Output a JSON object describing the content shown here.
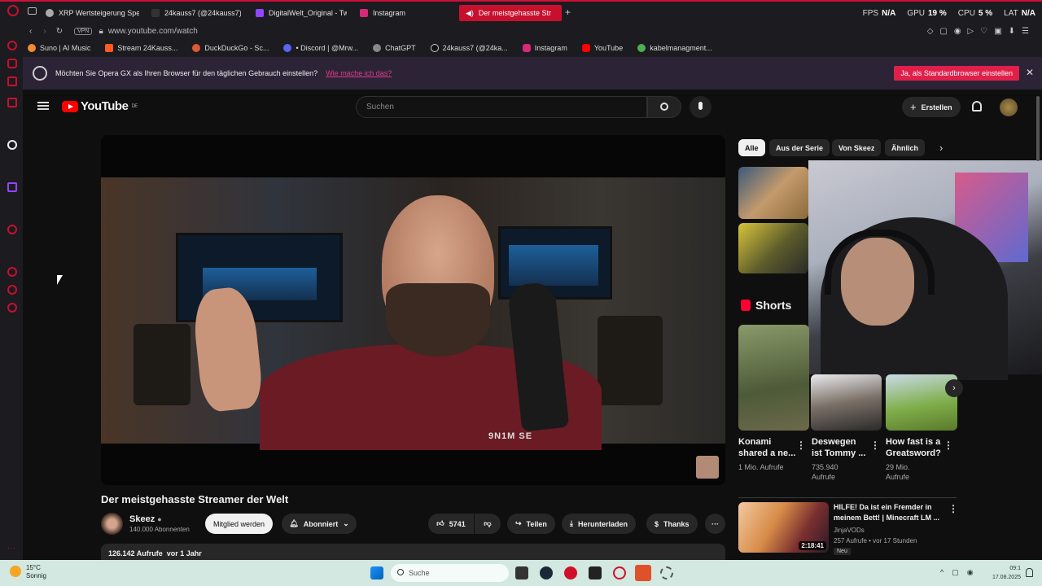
{
  "browser": {
    "tabs": [
      {
        "label": "XRP Wertsteigerung Spe..."
      },
      {
        "label": "24kauss7 (@24kauss7) |"
      },
      {
        "label": "DigitalWelt_Original - Twi"
      },
      {
        "label": "Instagram"
      },
      {
        "label": "Der meistgehasste Str"
      }
    ],
    "stats": {
      "fps_label": "FPS",
      "fps_value": "N/A",
      "gpu_label": "GPU",
      "gpu_value": "19 %",
      "cpu_label": "CPU",
      "cpu_value": "5 %",
      "lat_label": "LAT",
      "lat_value": "N/A"
    },
    "vpn_label": "VPN",
    "url": "www.youtube.com/watch",
    "bookmarks": [
      {
        "label": "Suno | AI Music",
        "color": "#f28b30"
      },
      {
        "label": "Stream 24Kauss...",
        "color": "#ff5a1f"
      },
      {
        "label": "DuckDuckGo - Sc...",
        "color": "#de5833"
      },
      {
        "label": "• Discord | @Mrw...",
        "color": "#5865f2"
      },
      {
        "label": "ChatGPT",
        "color": "#888888"
      },
      {
        "label": "24kauss7 (@24ka...",
        "color": "#222222"
      },
      {
        "label": "Instagram",
        "color": "#d62976"
      },
      {
        "label": "YouTube",
        "color": "#ff0000"
      },
      {
        "label": "kabelmanagment...",
        "color": "#4caf50"
      }
    ],
    "infobar": {
      "text": "Möchten Sie Opera GX als Ihren Browser für den täglichen Gebrauch einstellen?",
      "link": "Wie mache ich das?",
      "cta": "Ja, als Standardbrowser einstellen",
      "close": "✕"
    }
  },
  "youtube": {
    "logo_text": "YouTube",
    "logo_region": "DE",
    "search_placeholder": "Suchen",
    "create_label": "Erstellen",
    "video": {
      "watermark": "9N1M SE",
      "title": "Der meistgehasste Streamer der Welt",
      "channel": "Skeez",
      "subscribers": "140.000 Abonnenten",
      "join_label": "Mitglied werden",
      "subscribed_label": "Abonniert",
      "likes": "5741",
      "share_label": "Teilen",
      "download_label": "Herunterladen",
      "thanks_label": "Thanks",
      "views": "126.142 Aufrufe",
      "age": "vor 1 Jahr"
    },
    "chips": [
      "Alle",
      "Aus der Serie",
      "Von Skeez",
      "Ähnlich"
    ],
    "shorts_title": "Shorts",
    "shorts": [
      {
        "title_l1": "Konami",
        "title_l2": "shared a ne...",
        "meta_l1": "1 Mio. Aufrufe",
        "meta_l2": ""
      },
      {
        "title_l1": "Deswegen",
        "title_l2": "ist Tommy ...",
        "meta_l1": "735.940",
        "meta_l2": "Aufrufe"
      },
      {
        "title_l1": "How fast is a",
        "title_l2": "Greatsword?",
        "meta_l1": "29 Mio.",
        "meta_l2": "Aufrufe"
      }
    ],
    "rec_video": {
      "title_l1": "HILFE! Da ist ein Fremder in",
      "title_l2": "meinem Bett! | Minecraft LM ...",
      "channel": "JinjaVODs",
      "meta": "257 Aufrufe • vor 17 Stunden",
      "badge": "Neu",
      "duration": "2:18:41"
    }
  },
  "taskbar": {
    "temp": "15°C",
    "weather": "Sonnig",
    "search_placeholder": "Suche",
    "time": "09:1",
    "date": "17.08.2025"
  }
}
